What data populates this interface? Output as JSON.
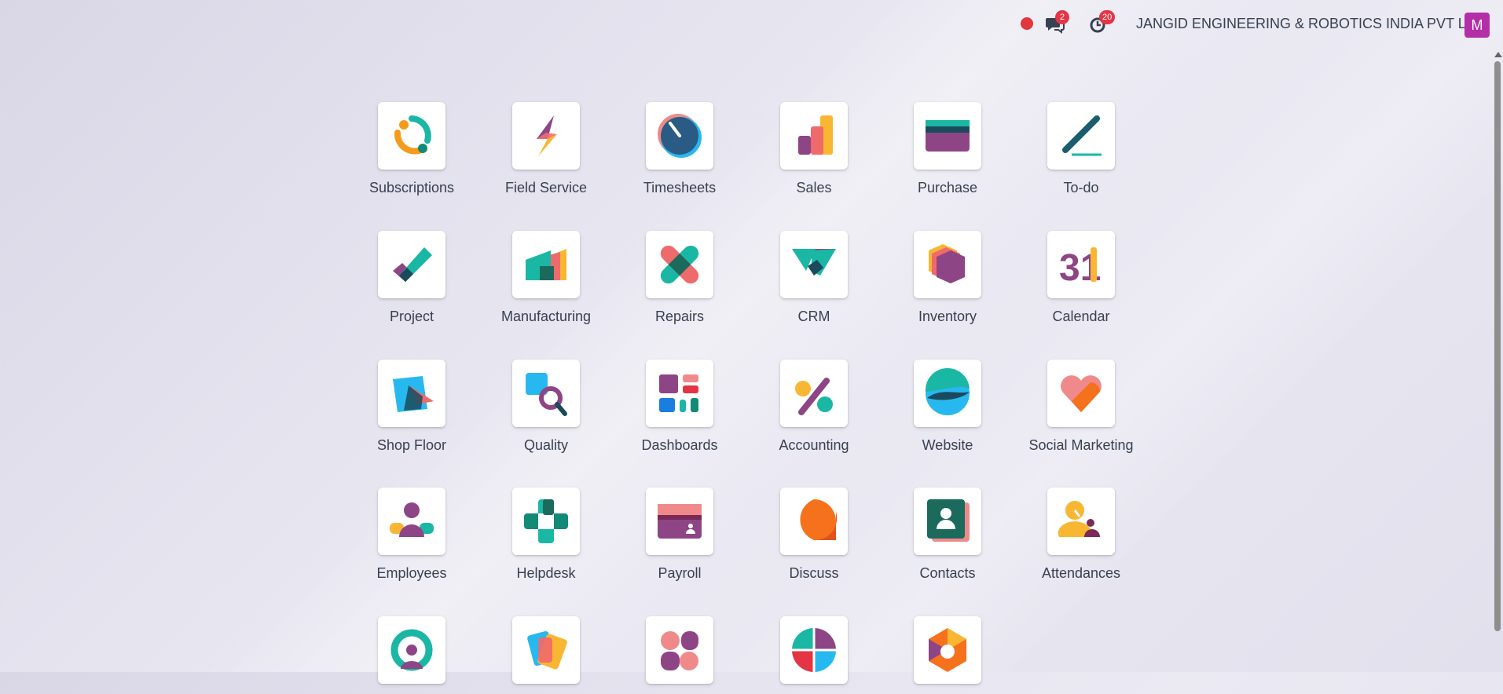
{
  "topbar": {
    "messages_badge": "2",
    "activities_badge": "20",
    "company": "JANGID ENGINEERING & ROBOTICS INDIA PVT LTD.",
    "avatar_letter": "M"
  },
  "apps": [
    {
      "label": "Subscriptions",
      "icon": "subscriptions-icon"
    },
    {
      "label": "Field Service",
      "icon": "field-service-icon"
    },
    {
      "label": "Timesheets",
      "icon": "timesheets-icon"
    },
    {
      "label": "Sales",
      "icon": "sales-icon"
    },
    {
      "label": "Purchase",
      "icon": "purchase-icon"
    },
    {
      "label": "To-do",
      "icon": "todo-icon"
    },
    {
      "label": "Project",
      "icon": "project-icon"
    },
    {
      "label": "Manufacturing",
      "icon": "manufacturing-icon"
    },
    {
      "label": "Repairs",
      "icon": "repairs-icon"
    },
    {
      "label": "CRM",
      "icon": "crm-icon"
    },
    {
      "label": "Inventory",
      "icon": "inventory-icon"
    },
    {
      "label": "Calendar",
      "icon": "calendar-icon",
      "number": "31"
    },
    {
      "label": "Shop Floor",
      "icon": "shop-floor-icon"
    },
    {
      "label": "Quality",
      "icon": "quality-icon"
    },
    {
      "label": "Dashboards",
      "icon": "dashboards-icon"
    },
    {
      "label": "Accounting",
      "icon": "accounting-icon"
    },
    {
      "label": "Website",
      "icon": "website-icon"
    },
    {
      "label": "Social Marketing",
      "icon": "social-marketing-icon"
    },
    {
      "label": "Employees",
      "icon": "employees-icon"
    },
    {
      "label": "Helpdesk",
      "icon": "helpdesk-icon"
    },
    {
      "label": "Payroll",
      "icon": "payroll-icon"
    },
    {
      "label": "Discuss",
      "icon": "discuss-icon"
    },
    {
      "label": "Contacts",
      "icon": "contacts-icon"
    },
    {
      "label": "Attendances",
      "icon": "attendances-icon"
    },
    {
      "label": "",
      "icon": "app-icon-25"
    },
    {
      "label": "",
      "icon": "app-icon-26"
    },
    {
      "label": "",
      "icon": "app-icon-27"
    },
    {
      "label": "",
      "icon": "app-icon-28"
    },
    {
      "label": "",
      "icon": "app-icon-29"
    }
  ]
}
